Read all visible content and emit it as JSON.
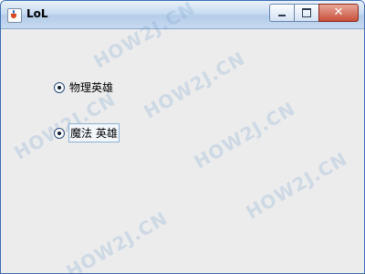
{
  "window": {
    "title": "LoL",
    "controls": [
      "minimize",
      "maximize",
      "close"
    ],
    "close_symbol": "✕"
  },
  "radios": [
    {
      "label": "物理英雄",
      "checked": true
    },
    {
      "label": "魔法 英雄",
      "checked": true
    }
  ],
  "watermark": "HOW2J.CN"
}
